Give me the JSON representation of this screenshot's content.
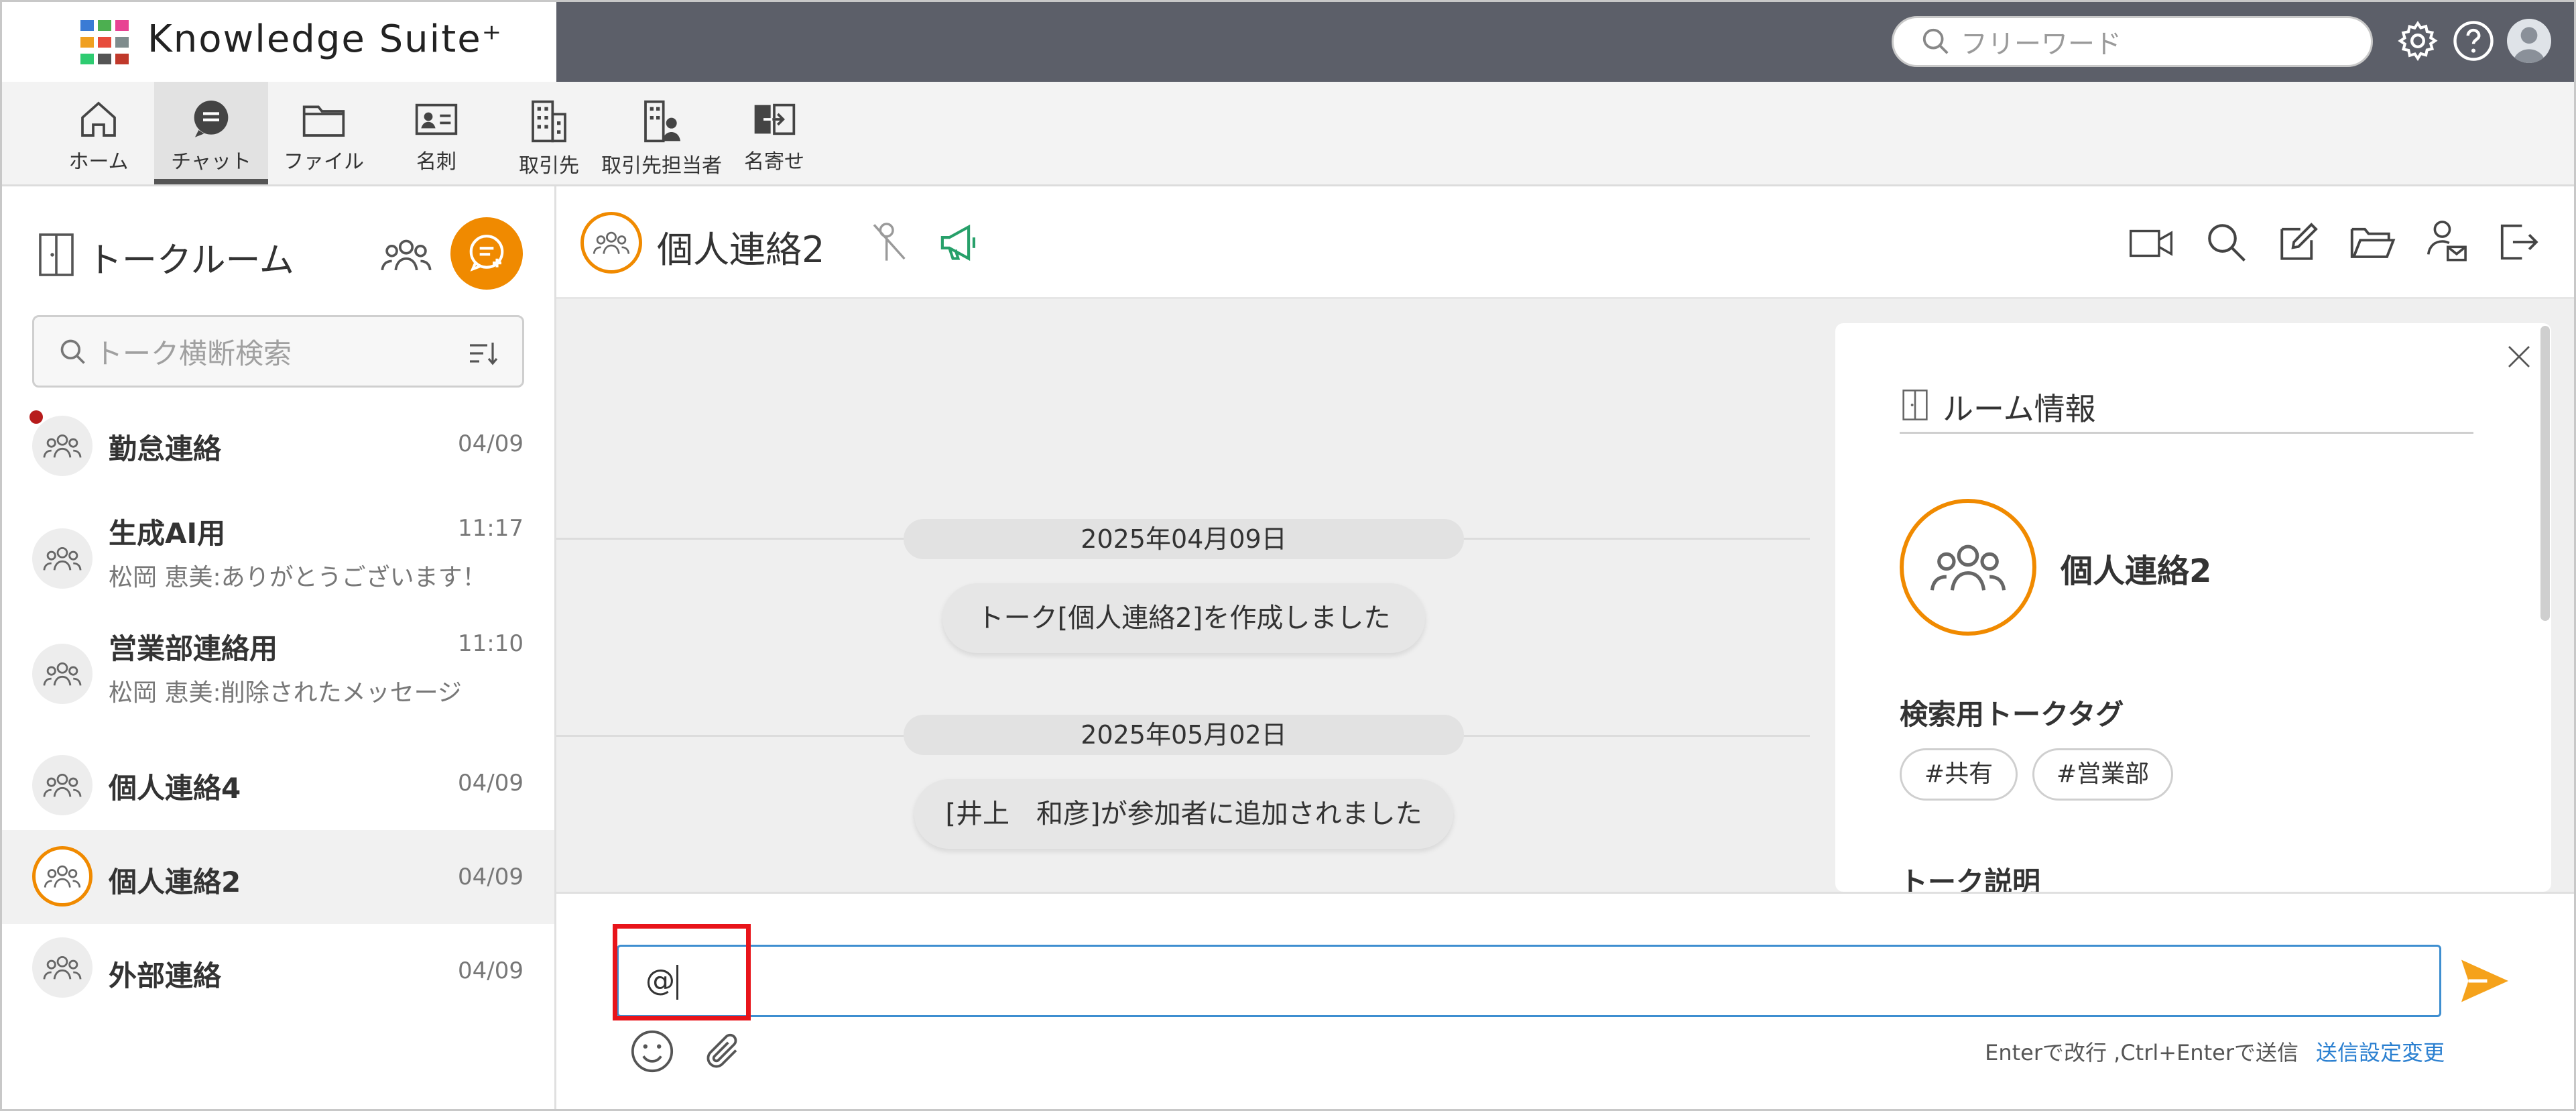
{
  "app": {
    "brand": "Knowledge Suite⁺"
  },
  "colors": {
    "accent": "#f08a00",
    "topbar": "#5c5f69",
    "send": "#f5a21b",
    "link": "#2a7fd0",
    "highlight": "#e8141a"
  },
  "topbar": {
    "search_placeholder": "フリーワード",
    "icons": [
      "gear-icon",
      "help-icon",
      "user-avatar"
    ]
  },
  "toolbar": {
    "items": [
      {
        "label": "ホーム",
        "icon": "home-icon"
      },
      {
        "label": "チャット",
        "icon": "chat-icon",
        "active": true
      },
      {
        "label": "ファイル",
        "icon": "folder-icon"
      },
      {
        "label": "名刺",
        "icon": "business-card-icon"
      },
      {
        "label": "取引先",
        "icon": "building-icon"
      },
      {
        "label": "取引先担当者",
        "icon": "building-person-icon"
      },
      {
        "label": "名寄せ",
        "icon": "merge-icon"
      }
    ]
  },
  "sidebar": {
    "title": "トークルーム",
    "search_placeholder": "トーク横断検索",
    "rooms": [
      {
        "name": "勤怠連絡",
        "date": "04/09",
        "preview": "",
        "unread": true
      },
      {
        "name": "生成AI用",
        "date": "11:17",
        "preview": "松岡 恵美:ありがとうございます！"
      },
      {
        "name": "営業部連絡用",
        "date": "11:10",
        "preview": "松岡 恵美:削除されたメッセージ"
      },
      {
        "name": "個人連絡4",
        "date": "04/09",
        "preview": ""
      },
      {
        "name": "個人連絡2",
        "date": "04/09",
        "preview": "",
        "active": true
      },
      {
        "name": "外部連絡",
        "date": "04/09",
        "preview": ""
      }
    ]
  },
  "chat": {
    "title": "個人連絡2",
    "messages": [
      {
        "date": "2025年04月09日",
        "text": "トーク[個人連絡2]を作成しました"
      },
      {
        "date": "2025年05月02日",
        "text": "[井上　和彦]が参加者に追加されました"
      }
    ]
  },
  "room_info": {
    "title": "ルーム情報",
    "room_name": "個人連絡2",
    "tags_title": "検索用トークタグ",
    "tags": [
      "#共有",
      "#営業部"
    ],
    "next_section": "トーク説明"
  },
  "composer": {
    "value": "@",
    "hint": "Enterで改行 ,Ctrl+Enterで送信",
    "settings_link": "送信設定変更"
  }
}
